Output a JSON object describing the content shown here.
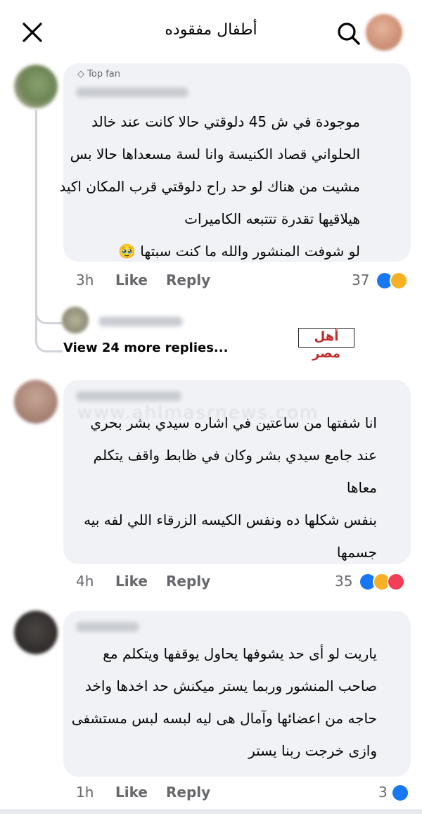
{
  "header": {
    "title": "أطفال مفقوده",
    "close_icon": "close-icon",
    "search_icon": "search-icon"
  },
  "comments": [
    {
      "badge": "Top fan",
      "lines": [
        "موجودة في ش 45 دلوقتي حالا كانت عند خالد",
        "الحلواني قصاد الكنيسة وانا لسة مسعداها حالا بس",
        "مشيت من هناك لو حد راح دلوقتي قرب المكان اكيد",
        "هيلاقيها تقدرة تتتبعه الكاميرات",
        "لو شوفت المنشور والله ما كنت سبتها 🥹"
      ],
      "time": "3h",
      "like": "Like",
      "reply": "Reply",
      "reaction_count": "37",
      "reactions": [
        "like",
        "sad"
      ]
    },
    {
      "lines": [
        "انا شفتها من ساعتين في اشاره سيدي بشر بحري",
        "عند جامع سيدي بشر وكان في ظابط واقف يتكلم",
        "معاها",
        "بنفس شكلها ده ونفس الكيسه الزرقاء اللي لفه بيه",
        "جسمها"
      ],
      "time": "4h",
      "like": "Like",
      "reply": "Reply",
      "reaction_count": "35",
      "reactions": [
        "like",
        "sad",
        "love"
      ]
    },
    {
      "lines": [
        "ياريت لو أى حد يشوفها يحاول يوقفها ويتكلم مع",
        "صاحب المنشور وربما يستر ميكنش حد اخدها واخد",
        "حاجه من اعضائها وآمال هى ليه لبسه لبس مستشفى",
        "وازى خرجت ربنا يستر"
      ],
      "time": "1h",
      "like": "Like",
      "reply": "Reply",
      "reaction_count": "3",
      "reactions": [
        "like"
      ]
    }
  ],
  "replies": {
    "view_more": "View 24 more replies..."
  },
  "watermark": {
    "logo_text": "أهل مصر",
    "url_text": "www.ahlmasrnews.com"
  },
  "colors": {
    "like_blue": "#1877f2",
    "sad_yellow": "#f7b125",
    "love_red": "#f33e58",
    "bubble_bg": "#f0f2f5",
    "meta_gray": "#65676b"
  }
}
